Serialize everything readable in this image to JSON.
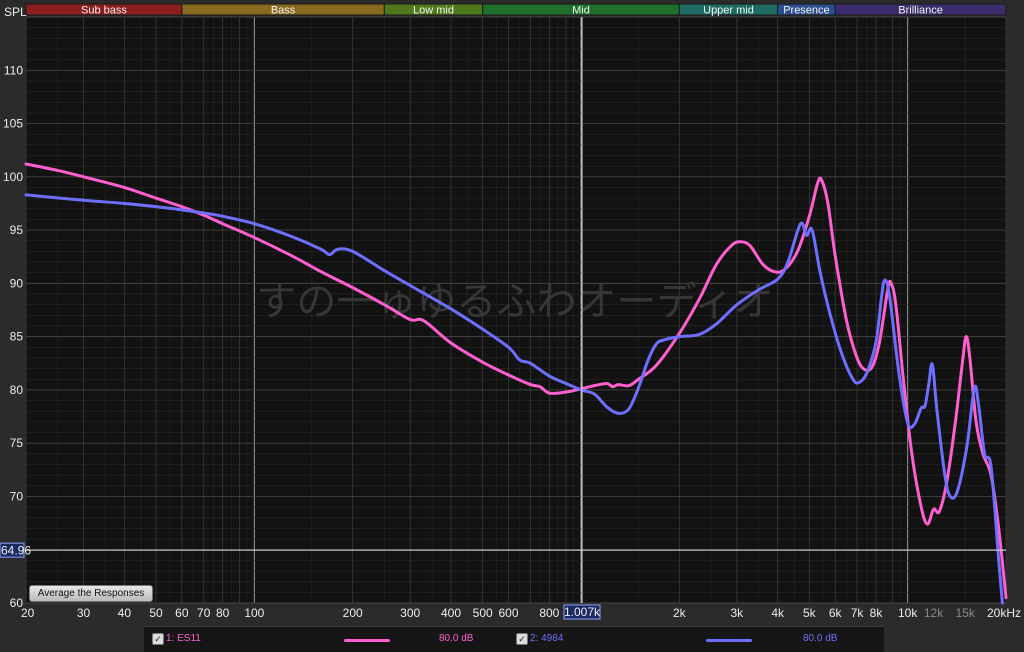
{
  "window": {
    "y_axis_title": "SPL"
  },
  "bands": [
    {
      "label": "Sub bass",
      "from": 20,
      "to": 60,
      "color": "#8c1e1e"
    },
    {
      "label": "Bass",
      "from": 60,
      "to": 250,
      "color": "#8a6a1e"
    },
    {
      "label": "Low mid",
      "from": 250,
      "to": 500,
      "color": "#4f7a1c"
    },
    {
      "label": "Mid",
      "from": 500,
      "to": 2000,
      "color": "#1d6f29"
    },
    {
      "label": "Upper mid",
      "from": 2000,
      "to": 4000,
      "color": "#1d6b63"
    },
    {
      "label": "Presence",
      "from": 4000,
      "to": 6000,
      "color": "#2c4f8f"
    },
    {
      "label": "Brilliance",
      "from": 6000,
      "to": 20000,
      "color": "#3b2c6d"
    }
  ],
  "watermark": "すの一ゅゆるふわオーディオ",
  "cursor": {
    "freq": 1007,
    "freq_label": "1.007k",
    "spl": 64.96,
    "spl_label": "64.96"
  },
  "controls": {
    "average_button": "Average the Responses"
  },
  "legend": [
    {
      "checked": "✓",
      "label": "1: ES11",
      "value": "80.0 dB",
      "color": "#ff5fcf"
    },
    {
      "checked": "✓",
      "label": "2: 4984",
      "value": "80.0 dB",
      "color": "#6f6fff"
    }
  ],
  "chart_data": {
    "type": "line",
    "xlabel": "",
    "ylabel": "SPL",
    "x_scale": "log",
    "xlim": [
      20,
      20000
    ],
    "ylim": [
      60,
      115
    ],
    "grid": true,
    "x_ticks": [
      {
        "v": 20,
        "label": "20"
      },
      {
        "v": 30,
        "label": "30"
      },
      {
        "v": 40,
        "label": "40"
      },
      {
        "v": 50,
        "label": "50"
      },
      {
        "v": 60,
        "label": "60"
      },
      {
        "v": 70,
        "label": "70"
      },
      {
        "v": 80,
        "label": "80"
      },
      {
        "v": 100,
        "label": "100"
      },
      {
        "v": 200,
        "label": "200"
      },
      {
        "v": 300,
        "label": "300"
      },
      {
        "v": 400,
        "label": "400"
      },
      {
        "v": 500,
        "label": "500"
      },
      {
        "v": 600,
        "label": "600"
      },
      {
        "v": 800,
        "label": "800"
      },
      {
        "v": 2000,
        "label": "2k"
      },
      {
        "v": 3000,
        "label": "3k"
      },
      {
        "v": 4000,
        "label": "4k"
      },
      {
        "v": 5000,
        "label": "5k"
      },
      {
        "v": 6000,
        "label": "6k"
      },
      {
        "v": 7000,
        "label": "7k"
      },
      {
        "v": 8000,
        "label": "8k"
      },
      {
        "v": 10000,
        "label": "10k"
      },
      {
        "v": 12000,
        "label": "12k",
        "dim": true
      },
      {
        "v": 15000,
        "label": "15k",
        "dim": true
      },
      {
        "v": 20000,
        "label": "20kHz"
      }
    ],
    "y_ticks": [
      65,
      70,
      75,
      80,
      85,
      90,
      95,
      100,
      105,
      110
    ],
    "series": [
      {
        "name": "1: ES11",
        "color": "#ff5fcf",
        "points": [
          [
            20,
            101.2
          ],
          [
            25,
            100.6
          ],
          [
            30,
            100.0
          ],
          [
            40,
            99.0
          ],
          [
            50,
            98.0
          ],
          [
            60,
            97.2
          ],
          [
            70,
            96.4
          ],
          [
            80,
            95.6
          ],
          [
            100,
            94.3
          ],
          [
            130,
            92.6
          ],
          [
            160,
            91.1
          ],
          [
            200,
            89.6
          ],
          [
            250,
            88.0
          ],
          [
            300,
            86.6
          ],
          [
            330,
            86.5
          ],
          [
            400,
            84.4
          ],
          [
            500,
            82.6
          ],
          [
            600,
            81.4
          ],
          [
            700,
            80.5
          ],
          [
            750,
            80.3
          ],
          [
            800,
            79.7
          ],
          [
            900,
            79.8
          ],
          [
            1000,
            80.1
          ],
          [
            1100,
            80.4
          ],
          [
            1200,
            80.6
          ],
          [
            1250,
            80.3
          ],
          [
            1300,
            80.5
          ],
          [
            1400,
            80.4
          ],
          [
            1500,
            81.0
          ],
          [
            1700,
            82.3
          ],
          [
            2000,
            85.3
          ],
          [
            2300,
            88.5
          ],
          [
            2600,
            91.8
          ],
          [
            2900,
            93.6
          ],
          [
            3100,
            93.9
          ],
          [
            3300,
            93.5
          ],
          [
            3600,
            91.8
          ],
          [
            3900,
            91.1
          ],
          [
            4200,
            91.3
          ],
          [
            4600,
            93.0
          ],
          [
            5000,
            96.3
          ],
          [
            5300,
            99.4
          ],
          [
            5450,
            99.7
          ],
          [
            5700,
            97.5
          ],
          [
            6000,
            92.6
          ],
          [
            6500,
            86.5
          ],
          [
            7000,
            83.0
          ],
          [
            7400,
            81.9
          ],
          [
            7800,
            82.2
          ],
          [
            8200,
            84.5
          ],
          [
            8700,
            89.5
          ],
          [
            8900,
            90.0
          ],
          [
            9200,
            88.0
          ],
          [
            9700,
            81.0
          ],
          [
            10300,
            74.0
          ],
          [
            11000,
            69.0
          ],
          [
            11500,
            67.4
          ],
          [
            12000,
            68.8
          ],
          [
            12500,
            68.6
          ],
          [
            13200,
            71.5
          ],
          [
            14000,
            77.0
          ],
          [
            14700,
            82.5
          ],
          [
            15100,
            85.0
          ],
          [
            15500,
            83.0
          ],
          [
            16200,
            77.0
          ],
          [
            17000,
            74.0
          ],
          [
            18000,
            72.0
          ],
          [
            19000,
            67.0
          ],
          [
            20000,
            60.5
          ]
        ]
      },
      {
        "name": "2: 4984",
        "color": "#6f6fff",
        "points": [
          [
            20,
            98.3
          ],
          [
            30,
            97.8
          ],
          [
            40,
            97.5
          ],
          [
            50,
            97.2
          ],
          [
            60,
            96.9
          ],
          [
            70,
            96.6
          ],
          [
            80,
            96.3
          ],
          [
            100,
            95.6
          ],
          [
            130,
            94.4
          ],
          [
            160,
            93.2
          ],
          [
            170,
            92.7
          ],
          [
            180,
            93.2
          ],
          [
            200,
            93.0
          ],
          [
            250,
            91.2
          ],
          [
            300,
            89.8
          ],
          [
            400,
            87.6
          ],
          [
            500,
            85.7
          ],
          [
            600,
            84.0
          ],
          [
            650,
            82.8
          ],
          [
            700,
            82.5
          ],
          [
            800,
            81.3
          ],
          [
            900,
            80.6
          ],
          [
            1000,
            80.0
          ],
          [
            1100,
            79.6
          ],
          [
            1200,
            78.4
          ],
          [
            1300,
            77.8
          ],
          [
            1400,
            78.2
          ],
          [
            1500,
            80.2
          ],
          [
            1600,
            82.7
          ],
          [
            1700,
            84.3
          ],
          [
            1800,
            84.7
          ],
          [
            2000,
            85.0
          ],
          [
            2300,
            85.2
          ],
          [
            2600,
            86.2
          ],
          [
            3000,
            88.0
          ],
          [
            3500,
            89.4
          ],
          [
            4000,
            90.4
          ],
          [
            4300,
            92.0
          ],
          [
            4700,
            95.6
          ],
          [
            4900,
            94.5
          ],
          [
            5100,
            95.0
          ],
          [
            5400,
            91.0
          ],
          [
            5800,
            87.0
          ],
          [
            6300,
            83.3
          ],
          [
            6800,
            81.0
          ],
          [
            7100,
            80.7
          ],
          [
            7500,
            81.6
          ],
          [
            8000,
            84.5
          ],
          [
            8300,
            88.5
          ],
          [
            8500,
            90.3
          ],
          [
            8800,
            88.8
          ],
          [
            9400,
            81.6
          ],
          [
            10000,
            76.9
          ],
          [
            10500,
            76.8
          ],
          [
            11000,
            78.3
          ],
          [
            11300,
            78.5
          ],
          [
            11600,
            80.5
          ],
          [
            11900,
            82.4
          ],
          [
            12300,
            78.0
          ],
          [
            13000,
            72.0
          ],
          [
            13500,
            70.0
          ],
          [
            14200,
            70.5
          ],
          [
            15200,
            74.8
          ],
          [
            16000,
            80.2
          ],
          [
            16500,
            78.5
          ],
          [
            17200,
            74.0
          ],
          [
            18000,
            72.8
          ],
          [
            19000,
            64.0
          ],
          [
            19500,
            60.0
          ]
        ]
      }
    ]
  }
}
